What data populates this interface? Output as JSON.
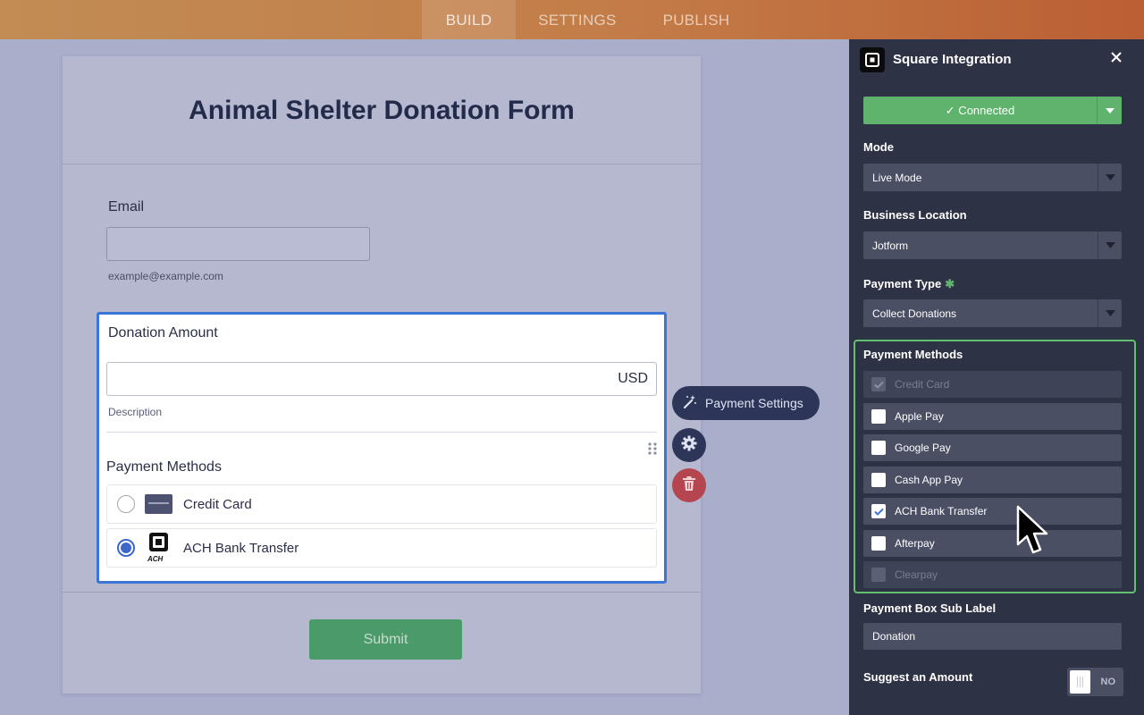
{
  "topnav": {
    "tabs": [
      "BUILD",
      "SETTINGS",
      "PUBLISH"
    ],
    "active": "BUILD"
  },
  "form": {
    "title": "Animal Shelter Donation Form",
    "email": {
      "label": "Email",
      "value": "",
      "sublabel": "example@example.com"
    },
    "donation": {
      "label": "Donation Amount",
      "amount": "",
      "currency": "USD",
      "description": "Description",
      "methods_label": "Payment Methods",
      "methods": [
        {
          "name": "Credit Card",
          "icon": "credit-card-icon",
          "selected": false
        },
        {
          "name": "ACH Bank Transfer",
          "icon": "square-ach-icon",
          "icon_text": "ACH",
          "selected": true
        }
      ]
    },
    "submit": "Submit"
  },
  "floating": {
    "payment_settings": "Payment Settings"
  },
  "panel": {
    "title": "Square Integration",
    "connected": "✓ Connected",
    "mode": {
      "label": "Mode",
      "value": "Live Mode"
    },
    "location": {
      "label": "Business Location",
      "value": "Jotform"
    },
    "payment_type": {
      "label": "Payment Type",
      "required": "✱",
      "value": "Collect Donations"
    },
    "methods": {
      "title": "Payment Methods",
      "items": [
        {
          "label": "Credit Card",
          "checked": true,
          "disabled": true
        },
        {
          "label": "Apple Pay",
          "checked": false,
          "disabled": false
        },
        {
          "label": "Google Pay",
          "checked": false,
          "disabled": false
        },
        {
          "label": "Cash App Pay",
          "checked": false,
          "disabled": false
        },
        {
          "label": "ACH Bank Transfer",
          "checked": true,
          "disabled": false
        },
        {
          "label": "Afterpay",
          "checked": false,
          "disabled": false
        },
        {
          "label": "Clearpay",
          "checked": false,
          "disabled": true
        }
      ]
    },
    "sublabel": {
      "label": "Payment Box Sub Label",
      "value": "Donation"
    },
    "suggest": {
      "label": "Suggest an Amount",
      "toggle": "NO"
    }
  },
  "colors": {
    "accent": "#3b76d6",
    "connected": "#5fb36d",
    "panel": "#2e3245",
    "delete": "#b5454e"
  }
}
